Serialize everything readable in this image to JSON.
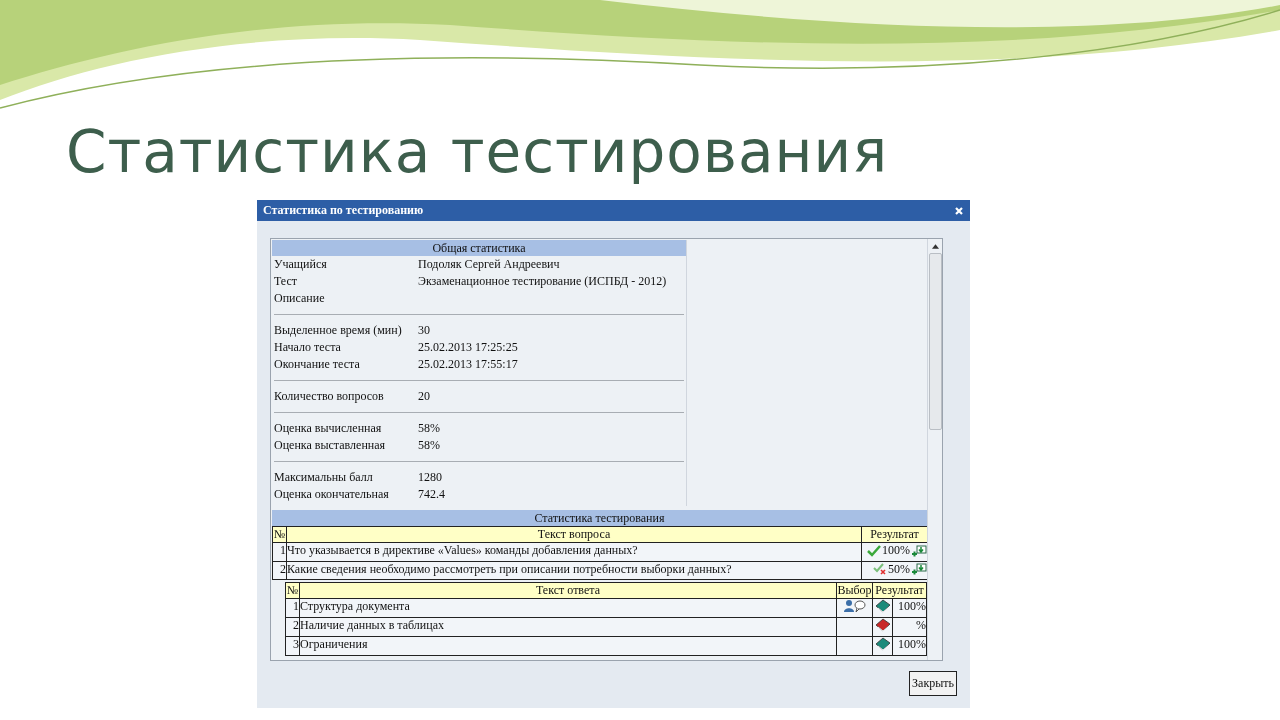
{
  "slide_title": "Статистика тестирования",
  "dialog": {
    "title": "Статистика по тестированию",
    "close_label": "Закрыть",
    "general": {
      "header": "Общая статистика",
      "groups": [
        [
          {
            "label": "Учащийся",
            "value": "Подоляк Сергей Андреевич"
          },
          {
            "label": "Тест",
            "value": "Экзаменационное тестирование (ИСПБД - 2012)"
          },
          {
            "label": "Описание"
          }
        ],
        [
          {
            "label": "Выделенное время (мин)",
            "value": "30"
          },
          {
            "label": "Начало теста",
            "value": "25.02.2013 17:25:25"
          },
          {
            "label": "Окончание теста",
            "value": "25.02.2013 17:55:17"
          }
        ],
        [
          {
            "label": "Количество вопросов",
            "value": "20"
          }
        ],
        [
          {
            "label": "Оценка вычисленная",
            "value": "58%"
          },
          {
            "label": "Оценка выставленная",
            "value": "58%"
          }
        ],
        [
          {
            "label": "Максимальны балл",
            "value": "1280"
          },
          {
            "label": "Оценка окончательная",
            "value": "742.4"
          }
        ]
      ]
    },
    "testing": {
      "header": "Статистика тестирования",
      "columns": [
        "№",
        "Текст вопроса",
        "Результат"
      ],
      "questions": [
        {
          "number": "1",
          "text": "Что указывается в директиве «Values» команды добавления данных?",
          "fully_correct": true,
          "result": "100%"
        },
        {
          "number": "2",
          "text": "Какие сведения необходимо рассмотреть при описании потребности выборки данных?",
          "fully_correct": false,
          "result": "50%"
        }
      ],
      "answer_columns": [
        "№",
        "Текст ответа",
        "Выбор",
        "Результат"
      ],
      "answers": [
        {
          "number": "1",
          "text": "Структура документа",
          "chosen": true,
          "correct": true,
          "result": "100%"
        },
        {
          "number": "2",
          "text": "Наличие данных в таблицах",
          "chosen": false,
          "correct": false,
          "result": "%"
        },
        {
          "number": "3",
          "text": "Ограничения",
          "chosen": false,
          "correct": true,
          "result": "100%"
        }
      ]
    }
  }
}
